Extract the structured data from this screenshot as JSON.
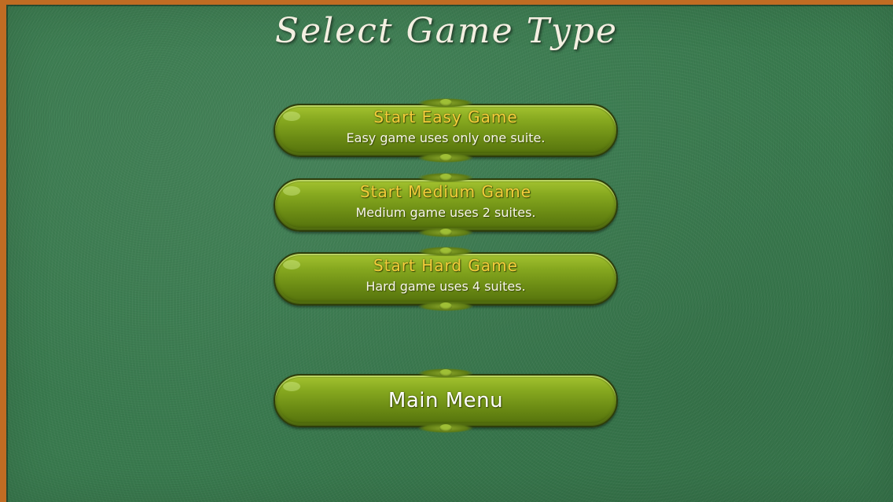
{
  "screen": {
    "title": "Select Game Type"
  },
  "buttons": {
    "easy": {
      "label": "Start Easy Game",
      "description": "Easy game uses only one suite."
    },
    "medium": {
      "label": "Start Medium Game",
      "description": "Medium game uses 2 suites."
    },
    "hard": {
      "label": "Start Hard Game",
      "description": "Hard game uses 4 suites."
    },
    "main_menu": {
      "label": "Main Menu"
    }
  },
  "colors": {
    "felt": "#3a7b4f",
    "frame": "#c06c23",
    "button_green": "#86a81f",
    "button_label": "#f4cc3b",
    "button_description": "#f7f5ea"
  }
}
